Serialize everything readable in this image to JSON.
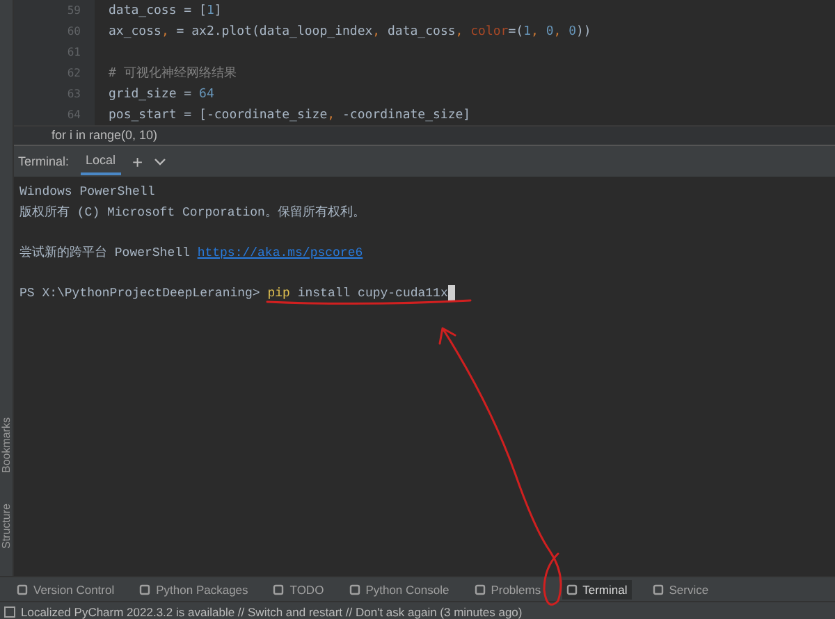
{
  "editor": {
    "lines": [
      {
        "number": "59",
        "tokens": [
          {
            "text": "data_coss = [",
            "kind": "plain"
          },
          {
            "text": "1",
            "kind": "number"
          },
          {
            "text": "]",
            "kind": "plain"
          }
        ]
      },
      {
        "number": "60",
        "tokens": [
          {
            "text": "ax_coss",
            "kind": "plain"
          },
          {
            "text": ",",
            "kind": "keyword"
          },
          {
            "text": " = ax2.plot(data_loop_index",
            "kind": "plain"
          },
          {
            "text": ",",
            "kind": "keyword"
          },
          {
            "text": " data_coss",
            "kind": "plain"
          },
          {
            "text": ",",
            "kind": "keyword"
          },
          {
            "text": " color",
            "kind": "param"
          },
          {
            "text": "=(",
            "kind": "plain"
          },
          {
            "text": "1",
            "kind": "number"
          },
          {
            "text": ", ",
            "kind": "keyword"
          },
          {
            "text": "0",
            "kind": "number"
          },
          {
            "text": ", ",
            "kind": "keyword"
          },
          {
            "text": "0",
            "kind": "number"
          },
          {
            "text": "))",
            "kind": "plain"
          }
        ]
      },
      {
        "number": "61"
      },
      {
        "number": "62",
        "tokens": [
          {
            "text": "# 可视化神经网络结果",
            "kind": "comment"
          }
        ]
      },
      {
        "number": "63",
        "tokens": [
          {
            "text": "grid_size = ",
            "kind": "plain"
          },
          {
            "text": "64",
            "kind": "number"
          }
        ]
      },
      {
        "number": "64",
        "tokens": [
          {
            "text": "pos_start = [-coordinate_size",
            "kind": "plain"
          },
          {
            "text": ",",
            "kind": "keyword"
          },
          {
            "text": " -coordinate_size]",
            "kind": "plain"
          }
        ]
      }
    ],
    "breadcrumb": "for i in range(0, 10)"
  },
  "terminal": {
    "label": "Terminal:",
    "tabs": [
      {
        "label": "Local",
        "selected": true
      }
    ],
    "add": "+",
    "lines": [
      {
        "parts": [
          {
            "text": "Windows PowerShell",
            "kind": "plain"
          }
        ]
      },
      {
        "parts": [
          {
            "text": "版权所有 (C) Microsoft Corporation。保留所有权利。",
            "kind": "plain"
          }
        ]
      },
      {
        "gap_before": true,
        "parts": [
          {
            "text": "尝试新的跨平台 PowerShell ",
            "kind": "plain"
          },
          {
            "text": "https://aka.ms/pscore6",
            "kind": "link"
          }
        ]
      },
      {
        "gap_before": true,
        "parts": [
          {
            "text": "PS X:\\PythonProjectDeepLeraning> ",
            "kind": "plain"
          },
          {
            "text": "pip",
            "kind": "command"
          },
          {
            "text": " install cupy-cuda11x",
            "kind": "plain"
          }
        ],
        "cursor": true
      }
    ]
  },
  "side_tools": [
    {
      "label": "Bookmarks"
    },
    {
      "label": "Structure"
    }
  ],
  "tool_windows": [
    {
      "label": "Version Control",
      "selected": false
    },
    {
      "label": "Python Packages",
      "selected": false
    },
    {
      "label": "TODO",
      "selected": false
    },
    {
      "label": "Python Console",
      "selected": false
    },
    {
      "label": "Problems",
      "selected": false
    },
    {
      "label": "Terminal",
      "selected": true
    },
    {
      "label": "Service",
      "selected": false
    }
  ],
  "status_bar": {
    "message": "Localized PyCharm 2022.3.2 is available // Switch and restart // Don't ask again (3 minutes ago)"
  }
}
